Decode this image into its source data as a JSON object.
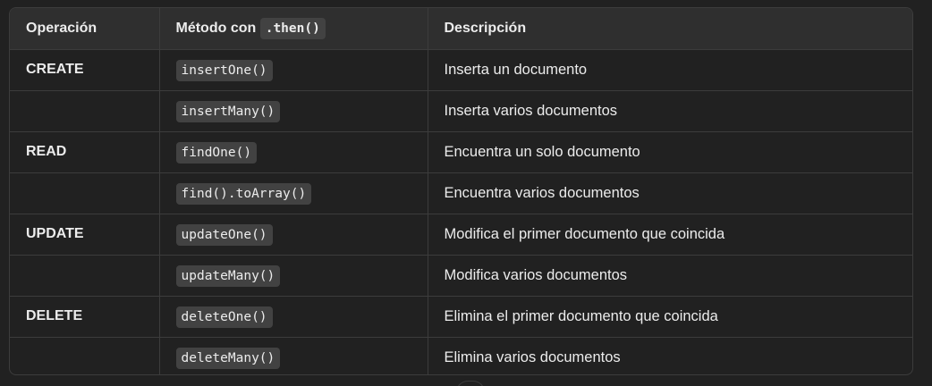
{
  "table": {
    "headers": {
      "operation": "Operación",
      "method_prefix": "Método con",
      "method_code": ".then()",
      "description": "Descripción"
    },
    "rows": [
      {
        "operation": "CREATE",
        "method": "insertOne()",
        "description": "Inserta un documento"
      },
      {
        "operation": "",
        "method": "insertMany()",
        "description": "Inserta varios documentos"
      },
      {
        "operation": "READ",
        "method": "findOne()",
        "description": "Encuentra un solo documento"
      },
      {
        "operation": "",
        "method": "find().toArray()",
        "description": "Encuentra varios documentos"
      },
      {
        "operation": "UPDATE",
        "method": "updateOne()",
        "description": "Modifica el primer documento que coincida"
      },
      {
        "operation": "",
        "method": "updateMany()",
        "description": "Modifica varios documentos"
      },
      {
        "operation": "DELETE",
        "method": "deleteOne()",
        "description": "Elimina el primer documento que coincida"
      },
      {
        "operation": "",
        "method": "deleteMany()",
        "description": "Elimina varios documentos"
      }
    ]
  },
  "colors": {
    "background": "#212121",
    "header_background": "#2f2f2f",
    "border": "#3c3c3c",
    "code_background": "#424242",
    "text": "#ececec"
  }
}
